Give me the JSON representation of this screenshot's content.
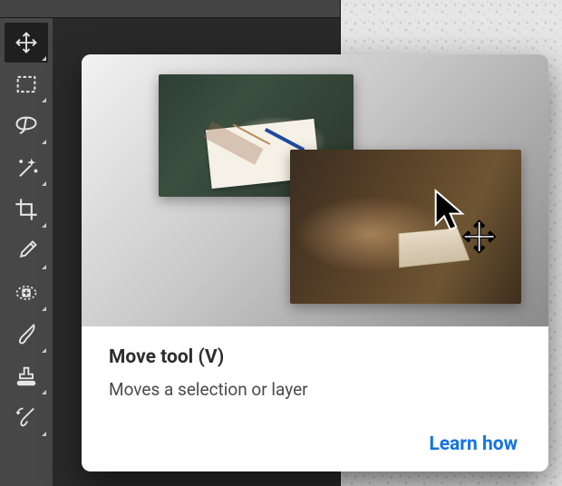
{
  "tools": [
    {
      "name": "move-tool",
      "label": "Move Tool",
      "selected": true
    },
    {
      "name": "rectangular-marquee-tool",
      "label": "Rectangular Marquee Tool",
      "selected": false
    },
    {
      "name": "lasso-tool",
      "label": "Lasso Tool",
      "selected": false
    },
    {
      "name": "magic-wand-tool",
      "label": "Magic Wand Tool",
      "selected": false
    },
    {
      "name": "crop-tool",
      "label": "Crop Tool",
      "selected": false
    },
    {
      "name": "eyedropper-tool",
      "label": "Eyedropper Tool",
      "selected": false
    },
    {
      "name": "healing-brush-tool",
      "label": "Healing Brush Tool",
      "selected": false
    },
    {
      "name": "brush-tool",
      "label": "Brush Tool",
      "selected": false
    },
    {
      "name": "clone-stamp-tool",
      "label": "Clone Stamp Tool",
      "selected": false
    },
    {
      "name": "history-brush-tool",
      "label": "History Brush Tool",
      "selected": false
    }
  ],
  "tooltip": {
    "title": "Move tool (V)",
    "description": "Moves a selection or layer",
    "link": "Learn how"
  }
}
